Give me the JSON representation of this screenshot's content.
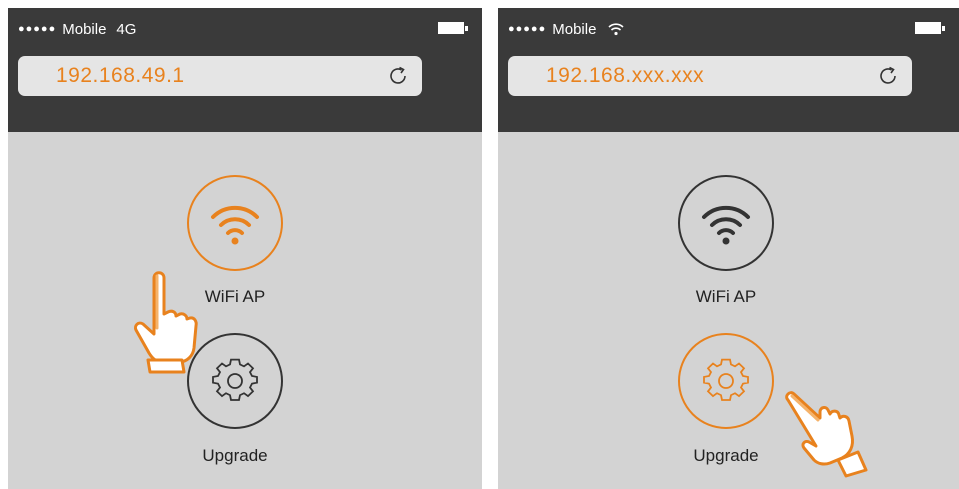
{
  "screens": [
    {
      "status": {
        "signal_dots": "●●●●●",
        "carrier": "Mobile",
        "network": "4G"
      },
      "address_bar": {
        "url": "192.168.49.1"
      },
      "buttons": {
        "wifi_ap": {
          "label": "WiFi AP",
          "active": true
        },
        "upgrade": {
          "label": "Upgrade",
          "active": false
        }
      }
    },
    {
      "status": {
        "signal_dots": "●●●●●",
        "carrier": "Mobile",
        "network": ""
      },
      "address_bar": {
        "url": "192.168.xxx.xxx"
      },
      "buttons": {
        "wifi_ap": {
          "label": "WiFi AP",
          "active": false
        },
        "upgrade": {
          "label": "Upgrade",
          "active": true
        }
      }
    }
  ],
  "colors": {
    "accent": "#e8821e",
    "topbar": "#3a3a3a",
    "background": "#d3d3d3",
    "dark_icon": "#333333"
  },
  "icons": [
    "reload-icon",
    "wifi-icon",
    "gear-icon",
    "hand-pointer-icon",
    "battery-icon",
    "wifi-signal-icon"
  ]
}
